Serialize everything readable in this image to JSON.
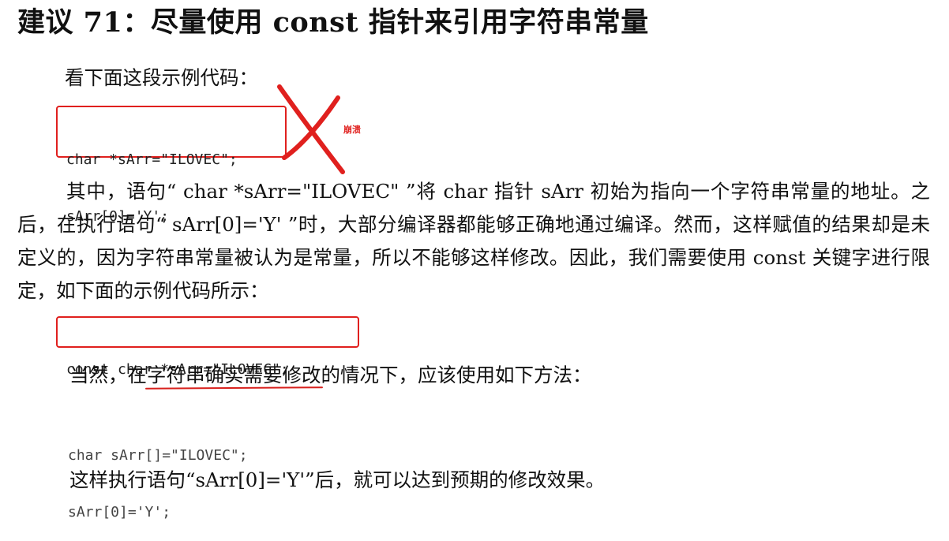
{
  "title": "建议 71：尽量使用 const 指针来引用字符串常量",
  "intro": "看下面这段示例代码：",
  "code_block_1": [
    "char *sArr=\"ILOVEC\";",
    "sArr[0]='Y';"
  ],
  "annotation": {
    "crash_label": "崩溃",
    "accent_color": "#e0201e"
  },
  "paragraph_1": "其中，语句“ char *sArr=\"ILOVEC\" ”将 char 指针 sArr 初始为指向一个字符串常量的地址。之后，在执行语句“ sArr[0]='Y' ”时，大部分编译器都能够正确地通过编译。然而，这样赋值的结果却是未定义的，因为字符串常量被认为是常量，所以不能够这样修改。因此，我们需要使用 const 关键字进行限定，如下面的示例代码所示：",
  "code_block_2": [
    "const char *sArr=\"ILOVEC\";"
  ],
  "paragraph_2": {
    "before": "当然，在",
    "underlined": "字符串确实需要修改",
    "after": "的情况下，应该使用如下方法："
  },
  "code_block_3": [
    "char sArr[]=\"ILOVEC\";",
    "sArr[0]='Y';"
  ],
  "paragraph_3": "这样执行语句“sArr[0]='Y'”后，就可以达到预期的修改效果。"
}
